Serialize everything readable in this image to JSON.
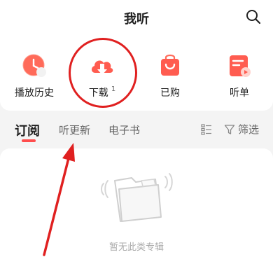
{
  "header": {
    "title": "我听"
  },
  "features": [
    {
      "label": "播放历史",
      "count": "",
      "icon": "history-icon"
    },
    {
      "label": "下载",
      "count": "1",
      "icon": "download-icon"
    },
    {
      "label": "已购",
      "count": "",
      "icon": "purchased-bag-icon"
    },
    {
      "label": "听单",
      "count": "",
      "icon": "playlist-icon"
    }
  ],
  "tabs": [
    {
      "label": "订阅",
      "active": true
    },
    {
      "label": "听更新",
      "active": false
    },
    {
      "label": "电子书",
      "active": false
    }
  ],
  "filter": {
    "label": "筛选"
  },
  "empty": {
    "text": "暂无此类专辑"
  },
  "colors": {
    "accent": "#ff4d4d",
    "annotation": "#e02020"
  }
}
